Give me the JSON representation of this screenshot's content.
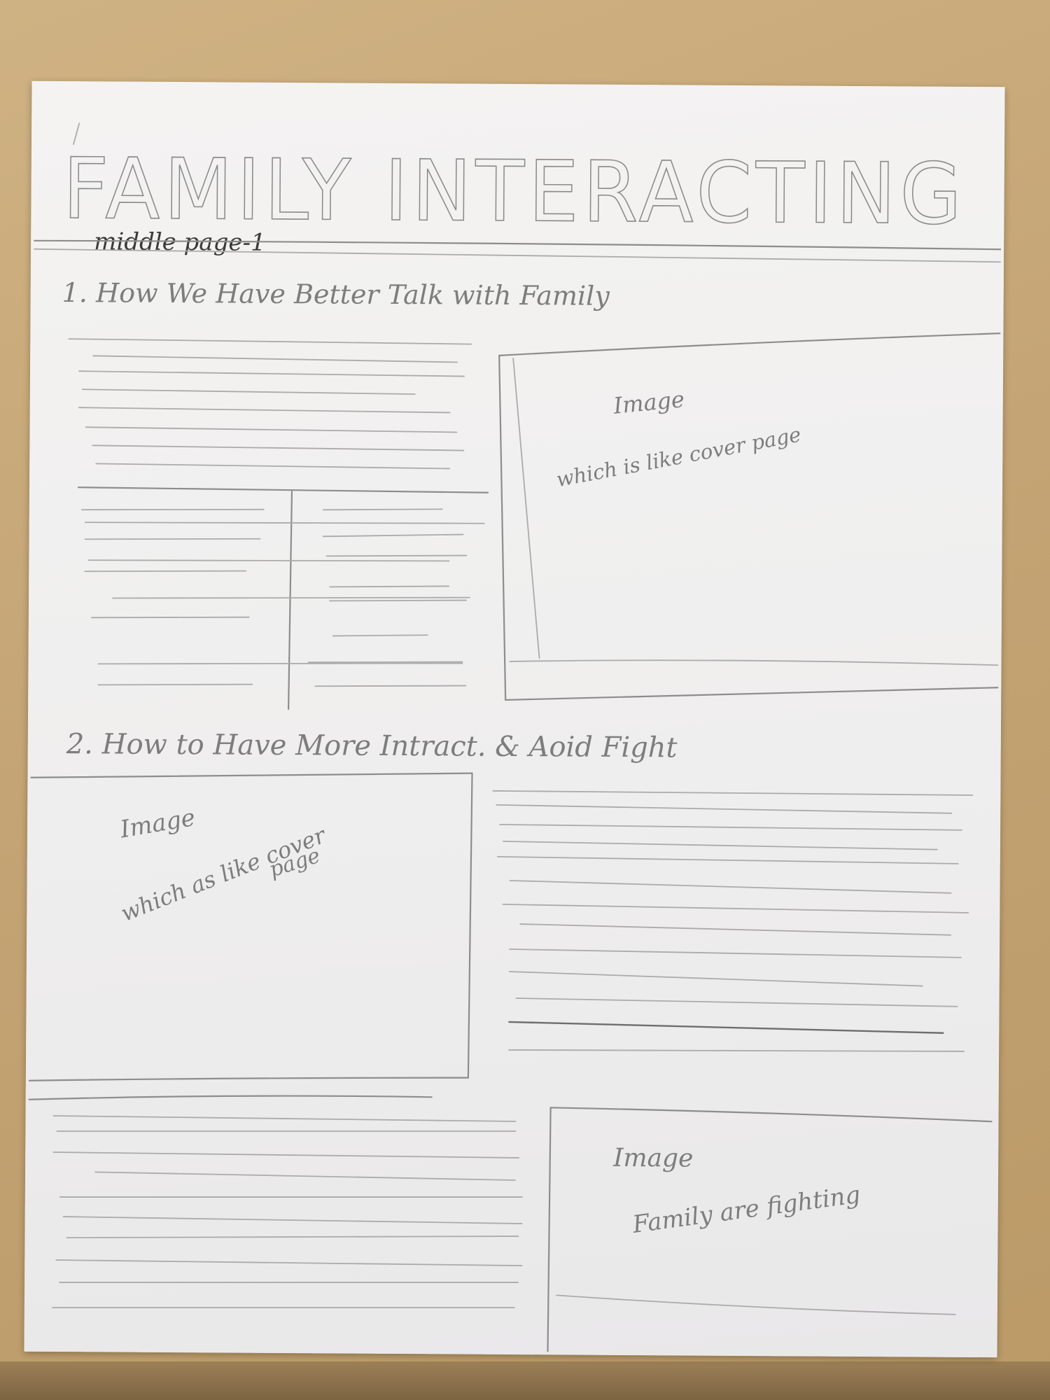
{
  "page": {
    "title": "FAMILY INTERACTING",
    "page_label": "middle page-1"
  },
  "section1": {
    "heading": "1. How We Have Better Talk with Family",
    "image_label": "Image",
    "image_caption": "which is like cover page"
  },
  "section2": {
    "heading": "2. How to Have More Intract. & Aoid Fight",
    "image_label": "Image",
    "image_caption_line1": "which as like cover",
    "image_caption_line2": "page"
  },
  "section3": {
    "image_label": "Image",
    "image_caption": "Family are fighting"
  }
}
